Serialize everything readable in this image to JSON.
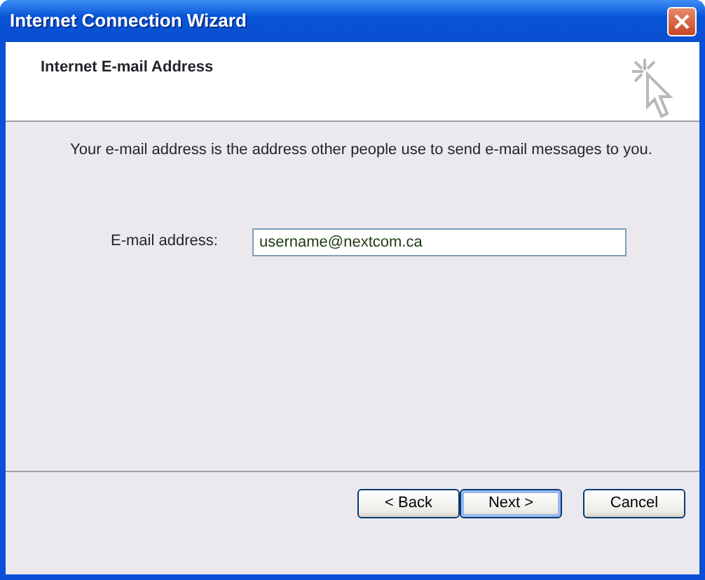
{
  "window": {
    "title": "Internet Connection Wizard"
  },
  "header": {
    "title": "Internet E-mail Address"
  },
  "description": "Your e-mail address is the address other people use to send e-mail messages to you.",
  "field": {
    "label": "E-mail address:",
    "value": "username@nextcom.ca"
  },
  "buttons": [
    {
      "label": "< Back",
      "default": false
    },
    {
      "label": "Next >",
      "default": true
    },
    {
      "label": "Cancel",
      "default": false
    }
  ]
}
